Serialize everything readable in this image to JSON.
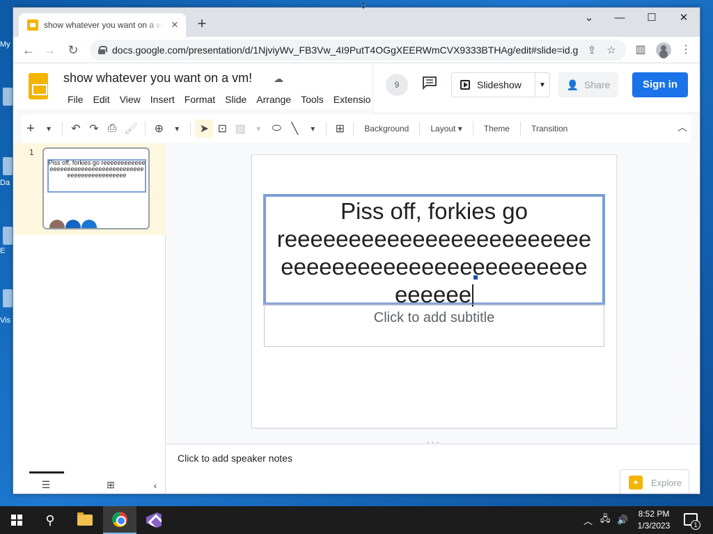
{
  "desktop": {
    "icons": [
      {
        "label": "My"
      },
      {
        "label": "Da"
      },
      {
        "label": "E"
      },
      {
        "label": "Vis"
      }
    ]
  },
  "browser": {
    "tab": {
      "title": "show whatever you want on a vm!",
      "close": "✕"
    },
    "new_tab": "+",
    "window_controls": {
      "dropdown": "⌄",
      "minimize": "—",
      "maximize": "☐",
      "close": "✕"
    },
    "nav": {
      "back": "←",
      "forward": "→",
      "reload": "↻"
    },
    "url": "docs.google.com/presentation/d/1NjviyWv_FB3Vw_4I9PutT4OGgXEERWmCVX9333BTHAg/edit#slide=id.g...",
    "omnibox_icons": [
      "share-icon",
      "star-icon"
    ],
    "right_icons": [
      "sidepanel-icon",
      "profile-icon",
      "menu-icon"
    ]
  },
  "app": {
    "title": "show whatever you want on a vm!",
    "menu": [
      "File",
      "Edit",
      "View",
      "Insert",
      "Format",
      "Slide",
      "Arrange",
      "Tools",
      "Extensio"
    ],
    "header": {
      "collaborators": "9",
      "slideshow": "Slideshow",
      "share": "Share",
      "sign_in": "Sign in"
    },
    "toolbar": {
      "background": "Background",
      "layout": "Layout",
      "theme": "Theme",
      "transition": "Transition"
    },
    "filmstrip": {
      "slide_number": "1",
      "thumb_text": "Piss off, forkies go reeeeeeeeeeeeeeeeeeeeeeeeeeeeeeeeeeeeeeeeeeeeeeeeeeeeeeee"
    },
    "slide": {
      "title_line1": "Piss off, forkies go",
      "title_line2": "reeeeeeeeeeeeeeeeeeeeeeee",
      "title_line3": "eeeeeeeeeeeeeeeeeeeeeeee",
      "title_line4": "eeeeee",
      "subtitle_placeholder": "Click to add subtitle"
    },
    "notes_placeholder": "Click to add speaker notes",
    "explore": "Explore"
  },
  "taskbar": {
    "time": "8:52 PM",
    "date": "1/3/2023",
    "notification_count": "1"
  },
  "colors": {
    "accent": "#1a73e8",
    "slides_yellow": "#f4b400",
    "selection_border": "#7b9fd6"
  }
}
